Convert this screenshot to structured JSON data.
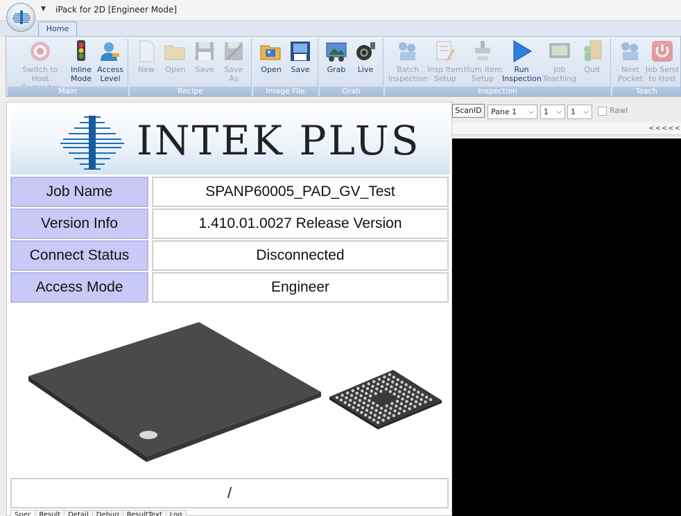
{
  "window": {
    "title": "iPack for 2D [Engineer Mode]"
  },
  "ribbon": {
    "tab": "Home",
    "groups": [
      {
        "label": "Main",
        "buttons": [
          {
            "label": "Switch to Host\nComputer",
            "icon": "target-icon",
            "enabled": false
          },
          {
            "label": "Inline\nMode",
            "icon": "traffic-light-icon",
            "enabled": true
          },
          {
            "label": "Access\nLevel",
            "icon": "user-key-icon",
            "enabled": true
          }
        ]
      },
      {
        "label": "Recipe",
        "buttons": [
          {
            "label": "New",
            "icon": "new-file-icon",
            "enabled": false
          },
          {
            "label": "Open",
            "icon": "open-folder-icon",
            "enabled": false
          },
          {
            "label": "Save",
            "icon": "floppy-icon",
            "enabled": false
          },
          {
            "label": "Save\nAs",
            "icon": "save-as-icon",
            "enabled": false
          }
        ]
      },
      {
        "label": "Image File",
        "buttons": [
          {
            "label": "Open",
            "icon": "image-folder-icon",
            "enabled": true
          },
          {
            "label": "Save",
            "icon": "image-save-icon",
            "enabled": true
          }
        ]
      },
      {
        "label": "Grab",
        "buttons": [
          {
            "label": "Grab",
            "icon": "grab-icon",
            "enabled": true
          },
          {
            "label": "Live",
            "icon": "camera-icon",
            "enabled": true
          }
        ]
      },
      {
        "label": "Inspection",
        "buttons": [
          {
            "label": "Batch\nInspection",
            "icon": "batch-icon",
            "enabled": false
          },
          {
            "label": "Insp Item\nSetup",
            "icon": "insp-setup-icon",
            "enabled": false
          },
          {
            "label": "Illum Item\nSetup",
            "icon": "illum-setup-icon",
            "enabled": false
          },
          {
            "label": "Run\nInspection",
            "icon": "play-icon",
            "enabled": true
          },
          {
            "label": "Job\nTeaching",
            "icon": "monitor-icon",
            "enabled": false
          },
          {
            "label": "Quit",
            "icon": "exit-icon",
            "enabled": false
          }
        ]
      },
      {
        "label": "Teach",
        "buttons": [
          {
            "label": "Next\nPocket",
            "icon": "next-pocket-icon",
            "enabled": false
          },
          {
            "label": "Job Send\nto Host",
            "icon": "power-icon",
            "enabled": false
          }
        ]
      }
    ]
  },
  "logo": {
    "text": "INTEK PLUS",
    "color": "#1a6fb5"
  },
  "info": [
    {
      "key": "Job Name",
      "value": "SPANP60005_PAD_GV_Test"
    },
    {
      "key": "Version Info",
      "value": "1.410.01.0027 Release Version"
    },
    {
      "key": "Connect Status",
      "value": "Disconnected"
    },
    {
      "key": "Access Mode",
      "value": "Engineer"
    }
  ],
  "bottom_field": "/",
  "bottom_tabs": [
    "Spec",
    "Result",
    "Detail",
    "Debug",
    "ResultText",
    "Log"
  ],
  "right": {
    "scanid": "ScanID",
    "pane_select": "Pane 1",
    "select2": "1",
    "select3": "1",
    "raw_label": "RawI",
    "scroll_arrows": "<<<<<"
  }
}
